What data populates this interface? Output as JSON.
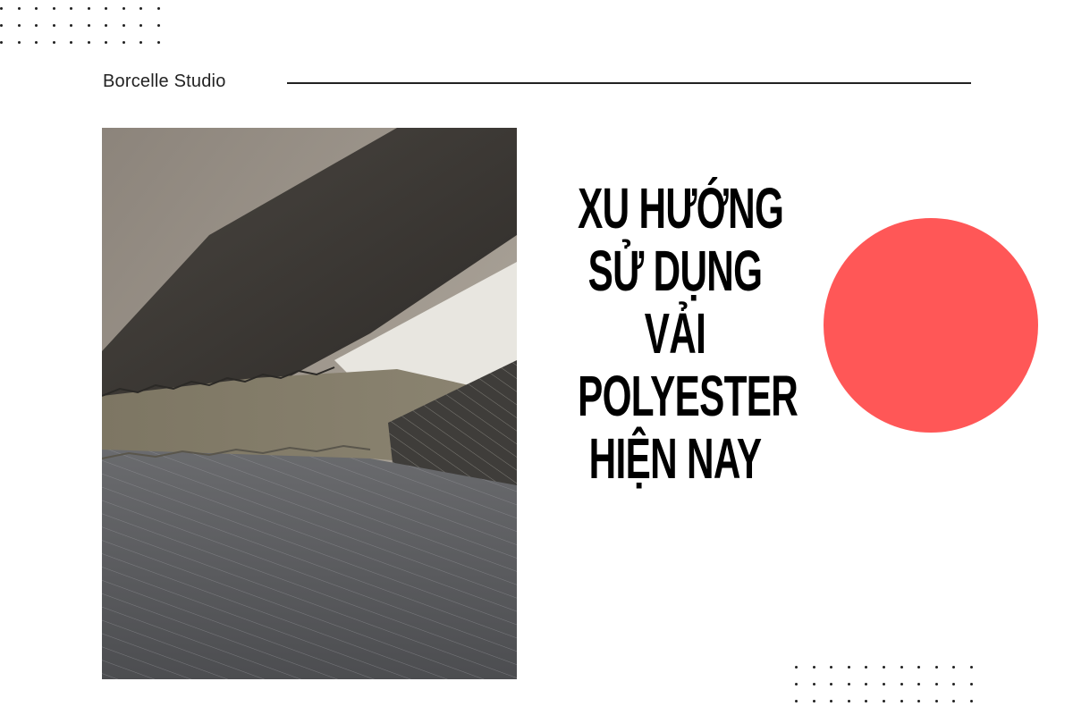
{
  "brand": {
    "name": "Borcelle Studio"
  },
  "headline": {
    "lines": [
      "XU HƯỚNG",
      "SỬ DỤNG",
      "VẢI",
      "POLYESTER",
      "HIỆN NAY"
    ]
  },
  "colors": {
    "accent_circle": "#ff5757",
    "text": "#000000",
    "background": "#ffffff"
  },
  "photo": {
    "icon": "fabric-swatches-photo"
  }
}
